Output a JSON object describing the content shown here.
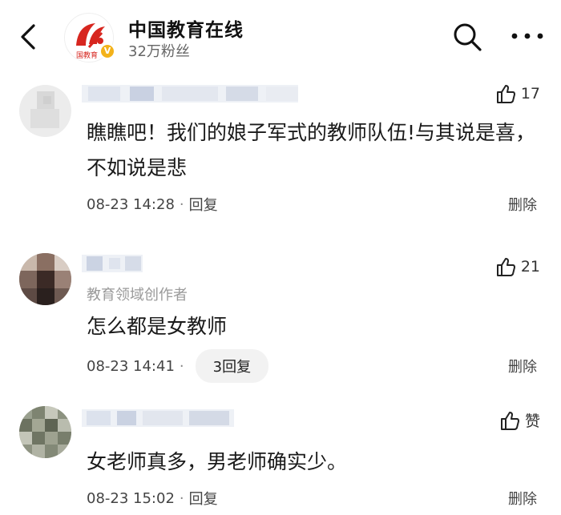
{
  "header": {
    "account_name": "中国教育在线",
    "followers": "32万粉丝",
    "logo_text": "国教育",
    "verified_mark": "V",
    "back_icon": "chevron-left-icon",
    "search_icon": "search-icon",
    "more_icon": "more-dots-icon"
  },
  "comments": [
    {
      "text": "瞧瞧吧！我们的娘子军式的教师队伍!与其说是喜，不如说是悲",
      "likes": "17",
      "time": "08-23 14:28",
      "reply_label": "回复",
      "delete_label": "删除"
    },
    {
      "role": "教育领域创作者",
      "text": "怎么都是女教师",
      "likes": "21",
      "time": "08-23 14:41",
      "reply_count_label": "3回复",
      "delete_label": "删除"
    },
    {
      "text": "女老师真多，男老师确实少。",
      "likes": "赞",
      "time": "08-23 15:02",
      "reply_label": "回复",
      "delete_label": "删除"
    }
  ],
  "colors": {
    "brand_red": "#d7261f",
    "verified_gold": "#f3b21a",
    "muted_text": "#9a9a9a",
    "pill_bg": "#f2f2f2"
  }
}
